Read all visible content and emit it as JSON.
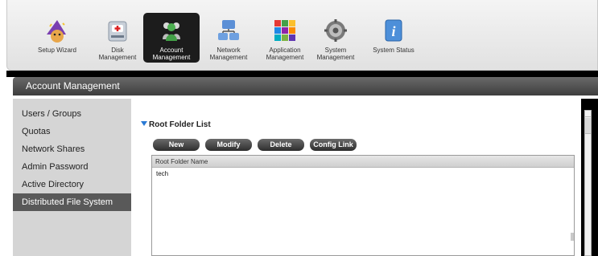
{
  "toolbar": {
    "items": [
      {
        "label": "Setup Wizard",
        "icon": "wizard-icon"
      },
      {
        "label": "Disk\nManagement",
        "icon": "disk-icon"
      },
      {
        "label": "Account\nManagement",
        "icon": "users-icon",
        "active": true
      },
      {
        "label": "Network\nManagement",
        "icon": "network-icon"
      },
      {
        "label": "Application\nManagement",
        "icon": "apps-icon"
      },
      {
        "label": "System\nManagement",
        "icon": "system-icon"
      },
      {
        "label": "System Status",
        "icon": "info-icon"
      }
    ]
  },
  "header": {
    "title": "Account Management"
  },
  "sidebar": {
    "items": [
      {
        "label": "Users / Groups"
      },
      {
        "label": "Quotas"
      },
      {
        "label": "Network Shares"
      },
      {
        "label": "Admin Password"
      },
      {
        "label": "Active Directory"
      },
      {
        "label": "Distributed File System",
        "active": true
      }
    ]
  },
  "main": {
    "section_title": "Root Folder List",
    "buttons": {
      "new": "New",
      "modify": "Modify",
      "delete": "Delete",
      "config_link": "Config Link"
    },
    "table": {
      "column_header": "Root Folder Name",
      "rows": [
        "tech"
      ]
    }
  },
  "colors": {
    "accent": "#2a7ad5",
    "active_tab": "#1c1c1c",
    "sidebar_active": "#595959"
  }
}
